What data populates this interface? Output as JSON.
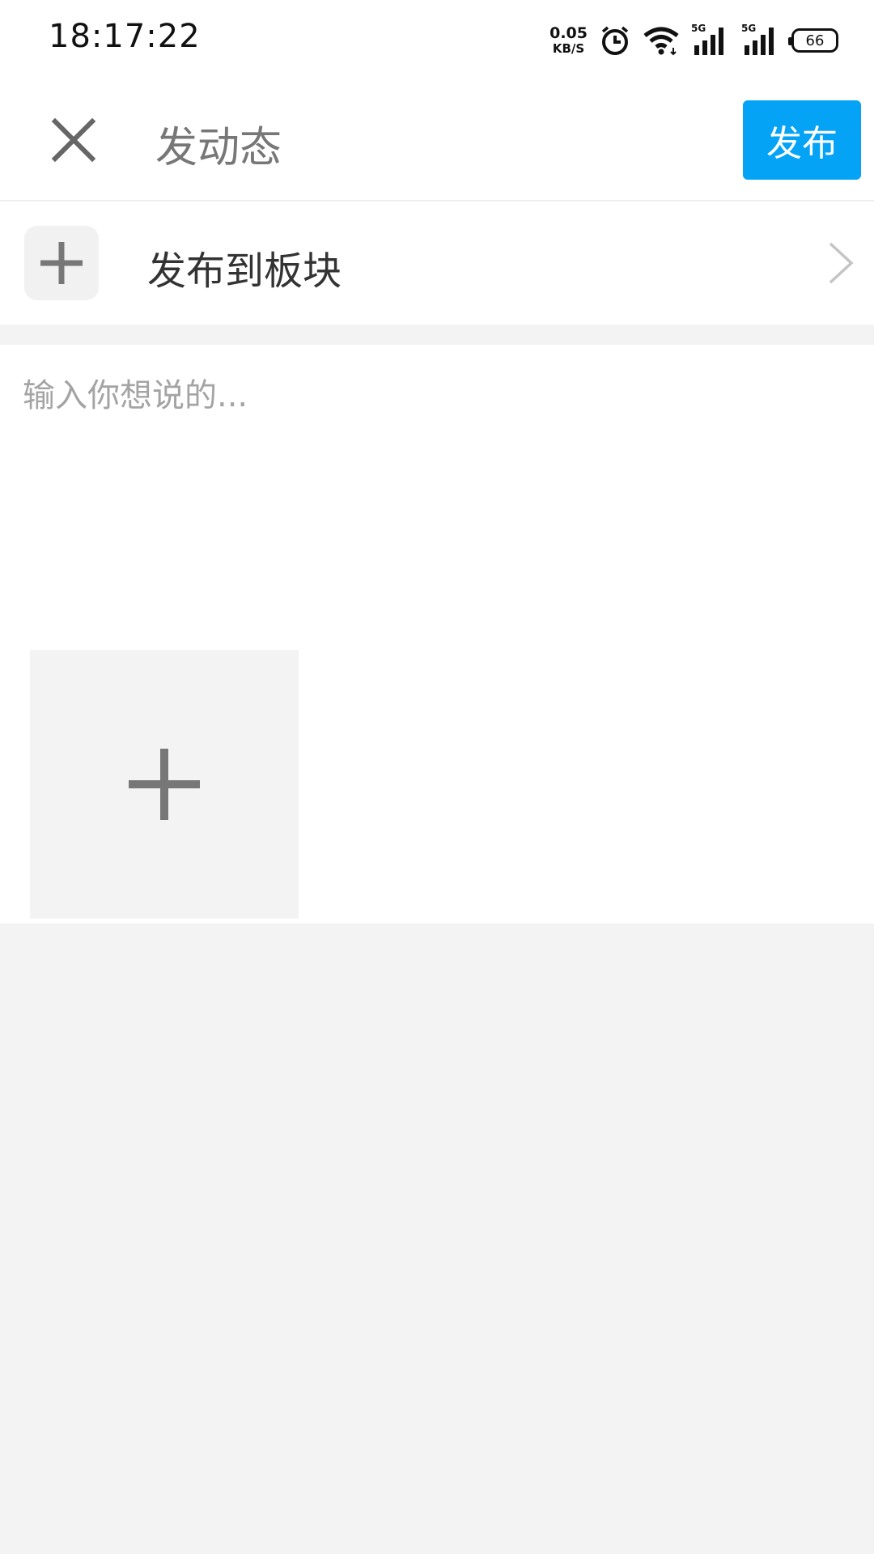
{
  "status_bar": {
    "time": "18:17:22",
    "net_speed_value": "0.05",
    "net_speed_unit": "KB/S",
    "sim1_tag": "5G",
    "sim2_tag": "5G",
    "battery": "66"
  },
  "header": {
    "title": "发动态",
    "publish_label": "发布"
  },
  "board": {
    "label": "发布到板块"
  },
  "editor": {
    "placeholder": "输入你想说的..."
  },
  "icons": {
    "close": "close-icon",
    "board_add": "plus-icon",
    "chevron": "chevron-right-icon",
    "image_add": "plus-icon"
  },
  "colors": {
    "accent": "#05a3f5",
    "page_bg": "#f3f3f3"
  }
}
